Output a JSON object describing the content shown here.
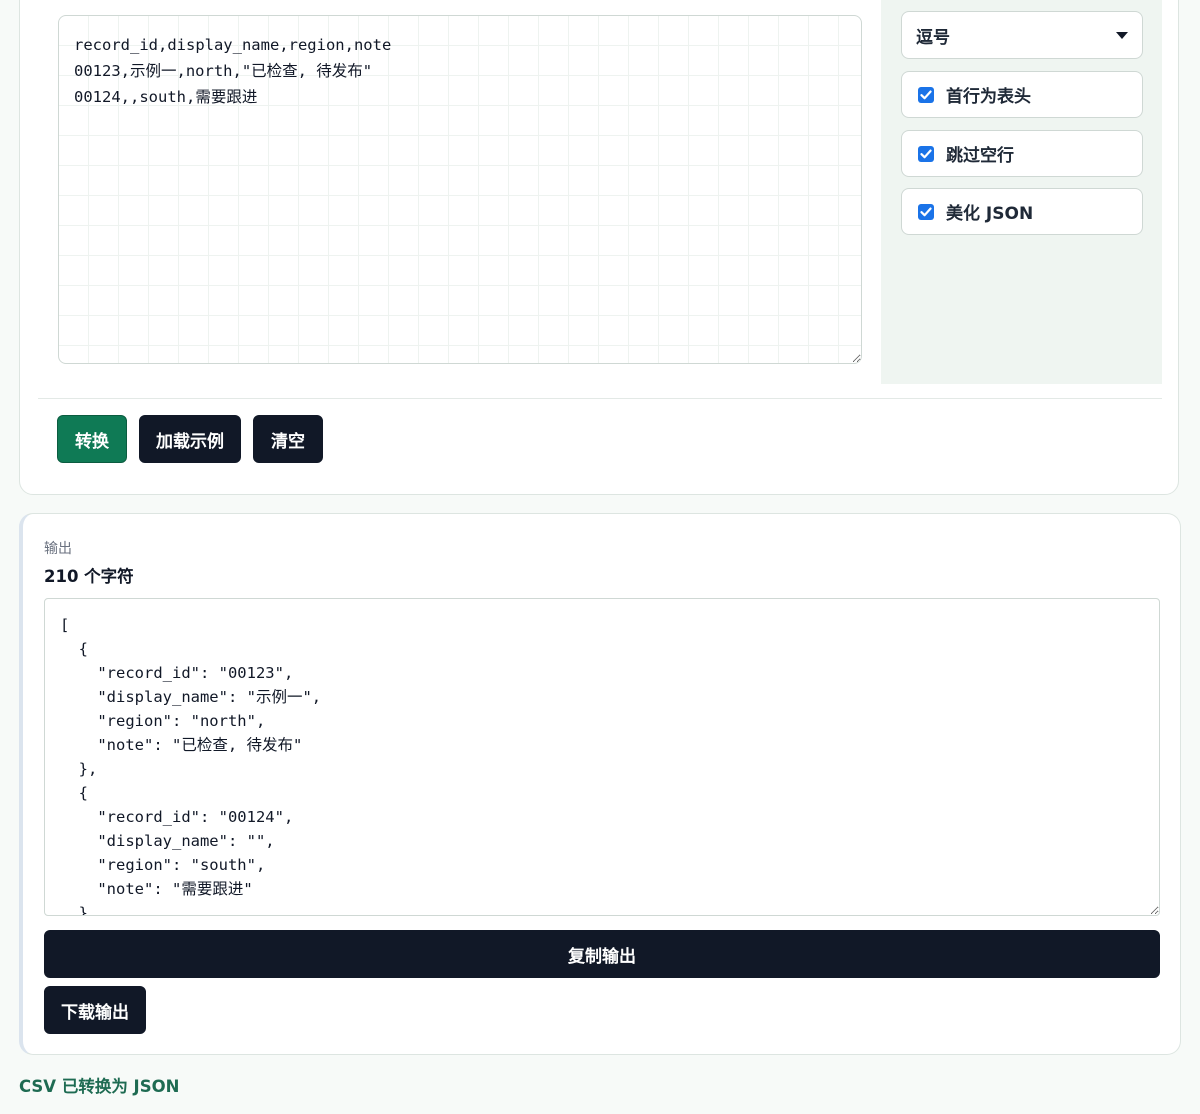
{
  "input": {
    "csv_text": "record_id,display_name,region,note\n00123,示例一,north,\"已检查, 待发布\"\n00124,,south,需要跟进"
  },
  "options": {
    "delimiter_value": "逗号",
    "header_row_label": "首行为表头",
    "header_row_checked": true,
    "skip_empty_label": "跳过空行",
    "skip_empty_checked": true,
    "pretty_json_label": "美化 JSON",
    "pretty_json_checked": true
  },
  "actions": {
    "convert_label": "转换",
    "load_sample_label": "加载示例",
    "clear_label": "清空"
  },
  "output": {
    "label": "输出",
    "char_count": "210 个字符",
    "json_text": "[\n  {\n    \"record_id\": \"00123\",\n    \"display_name\": \"示例一\",\n    \"region\": \"north\",\n    \"note\": \"已检查, 待发布\"\n  },\n  {\n    \"record_id\": \"00124\",\n    \"display_name\": \"\",\n    \"region\": \"south\",\n    \"note\": \"需要跟进\"\n  }\n]",
    "copy_label": "复制输出",
    "download_label": "下载输出"
  },
  "status": {
    "message": "CSV 已转换为 JSON"
  },
  "colors": {
    "primary": "#0f7a55",
    "dark": "#111827",
    "checkbox": "#1a73e8",
    "status": "#1e6b52"
  }
}
